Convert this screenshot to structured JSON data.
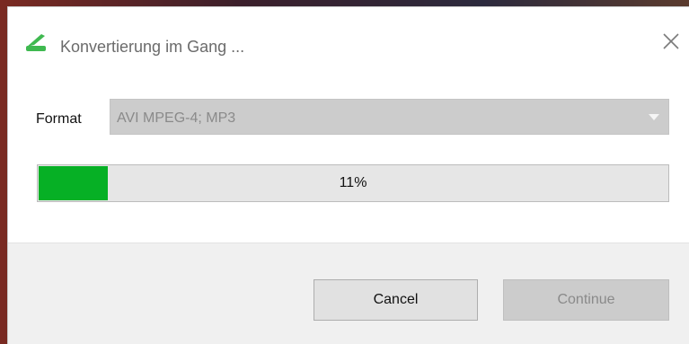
{
  "dialog": {
    "title": "Konvertierung im Gang ...",
    "app_icon": "green-converter-icon",
    "close_icon": "close-icon"
  },
  "format": {
    "label": "Format",
    "selected_value": "AVI MPEG-4; MP3",
    "disabled": true
  },
  "progress": {
    "percent_text": "11%",
    "fraction": 0.11,
    "fill_color": "#06b025"
  },
  "buttons": {
    "cancel_label": "Cancel",
    "continue_label": "Continue",
    "continue_disabled": true
  }
}
